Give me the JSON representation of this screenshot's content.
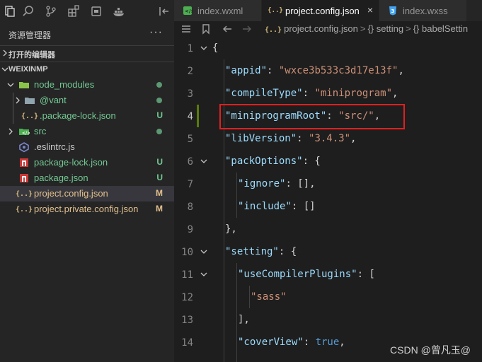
{
  "activity_bar": {
    "icons": [
      "files-icon",
      "search-icon",
      "source-control-icon",
      "extensions-icon",
      "calendar-icon",
      "docker-icon",
      "split-icon"
    ]
  },
  "explorer": {
    "title": "资源管理器",
    "more": "···",
    "open_editors_label": "打开的编辑器",
    "project_label": "WEIXINMP"
  },
  "tree": [
    {
      "name": "node_modules",
      "kind": "folder-open",
      "status": "dot"
    },
    {
      "name": "@vant",
      "kind": "folder",
      "status": "dot"
    },
    {
      "name": ".package-lock.json",
      "kind": "json",
      "status": "U"
    },
    {
      "name": "src",
      "kind": "folder-src",
      "status": "dot"
    },
    {
      "name": ".eslintrc.js",
      "kind": "eslint",
      "status": ""
    },
    {
      "name": "package-lock.json",
      "kind": "json",
      "status": "U"
    },
    {
      "name": "package.json",
      "kind": "json",
      "status": "U"
    },
    {
      "name": "project.config.json",
      "kind": "json",
      "status": "M"
    },
    {
      "name": "project.private.config.json",
      "kind": "json",
      "status": "M"
    }
  ],
  "tabs": [
    {
      "label": "index.wxml",
      "icon": "wxml-icon"
    },
    {
      "label": "project.config.json",
      "icon": "json-icon",
      "close": "×"
    },
    {
      "label": "index.wxss",
      "icon": "css-icon"
    }
  ],
  "breadcrumb": {
    "file": "project.config.json",
    "sep": ">",
    "path1": "setting",
    "path2": "babelSettin",
    "obj_icon": "{}"
  },
  "code_lines": [
    {
      "n": "1",
      "text": "{"
    },
    {
      "n": "2",
      "key": "\"appid\"",
      "val": "\"wxce3b533c3d17e13f\"",
      "tail": ","
    },
    {
      "n": "3",
      "key": "\"compileType\"",
      "val": "\"miniprogram\"",
      "tail": ","
    },
    {
      "n": "4",
      "key": "\"miniprogramRoot\"",
      "val": "\"src/\"",
      "tail": ","
    },
    {
      "n": "5",
      "key": "\"libVersion\"",
      "val": "\"3.4.3\"",
      "tail": ","
    },
    {
      "n": "6",
      "key": "\"packOptions\"",
      "tail": ": {"
    },
    {
      "n": "7",
      "key": "\"ignore\"",
      "tail": ": [],"
    },
    {
      "n": "8",
      "key": "\"include\"",
      "tail": ": []"
    },
    {
      "n": "9",
      "text": "},"
    },
    {
      "n": "10",
      "key": "\"setting\"",
      "tail": ": {"
    },
    {
      "n": "11",
      "key": "\"useCompilerPlugins\"",
      "tail": ": ["
    },
    {
      "n": "12",
      "val": "\"sass\""
    },
    {
      "n": "13",
      "text": "],"
    },
    {
      "n": "14",
      "key": "\"coverView\"",
      "bool": "true",
      "tail": ","
    }
  ],
  "watermark": "CSDN @曾凡玉@",
  "colors": {
    "accent_green": "#73c991",
    "highlight_red": "#e02020",
    "modified": "#e2c08d"
  }
}
